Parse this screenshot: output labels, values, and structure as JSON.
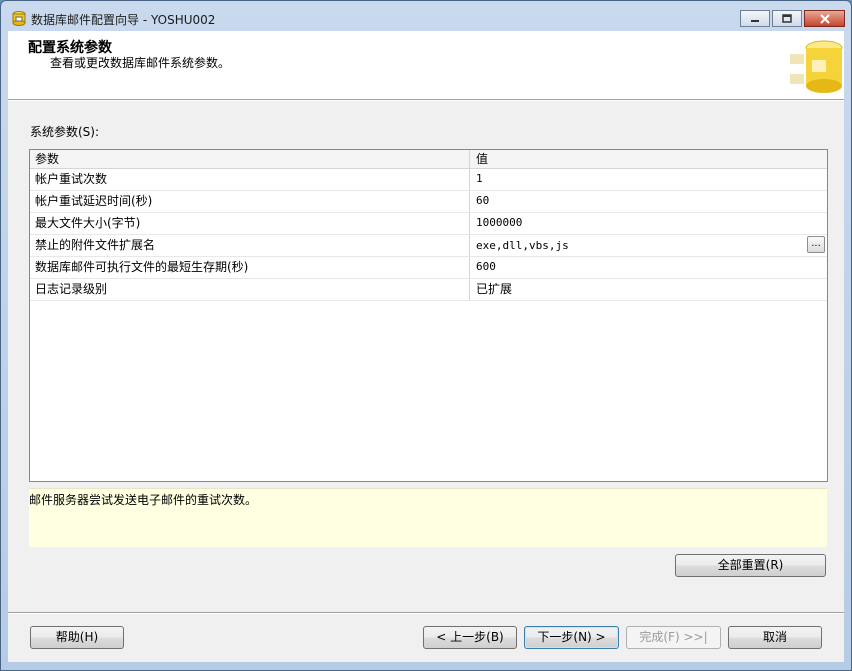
{
  "window": {
    "title": "数据库邮件配置向导 - YOSHU002"
  },
  "header": {
    "title": "配置系统参数",
    "subtitle": "查看或更改数据库邮件系统参数。"
  },
  "params_label": "系统参数(S):",
  "grid": {
    "headers": [
      "参数",
      "值"
    ],
    "rows": [
      {
        "name": "帐户重试次数",
        "value": "1"
      },
      {
        "name": "帐户重试延迟时间(秒)",
        "value": "60"
      },
      {
        "name": "最大文件大小(字节)",
        "value": "1000000"
      },
      {
        "name": "禁止的附件文件扩展名",
        "value": "exe,dll,vbs,js",
        "ellipsis": "..."
      },
      {
        "name": "数据库邮件可执行文件的最短生存期(秒)",
        "value": "600"
      },
      {
        "name": "日志记录级别",
        "value": "已扩展"
      }
    ]
  },
  "description": "邮件服务器尝试发送电子邮件的重试次数。",
  "buttons": {
    "reset_all": "全部重置(R)",
    "help": "帮助(H)",
    "back": "< 上一步(B)",
    "next": "下一步(N) >",
    "finish": "完成(F) >>|",
    "cancel": "取消"
  },
  "colors": {
    "description_bg": "#ffffe1",
    "close_button": "#c6452c"
  },
  "icons": {
    "app": "database-mail-icon",
    "header_logo": "database-icon"
  }
}
